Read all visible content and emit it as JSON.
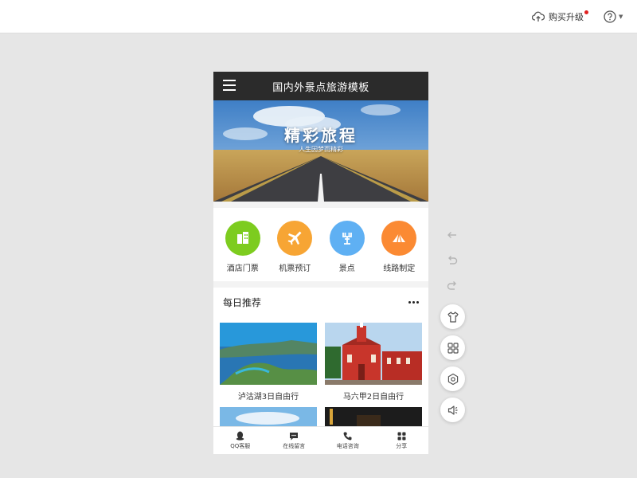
{
  "topbar": {
    "upgrade_label": "购买升级",
    "upgrade_icon": "cloud-upload-icon",
    "help_icon": "question-circle-icon"
  },
  "phone": {
    "title": "国内外景点旅游模板",
    "menu_icon": "hamburger-icon",
    "banner": {
      "headline": "精彩旅程",
      "subline": "人生因梦而精彩"
    },
    "quick_links": [
      {
        "label": "酒店门票",
        "icon": "hotel-building-icon",
        "color": "#7dcc1f"
      },
      {
        "label": "机票预订",
        "icon": "airplane-icon",
        "color": "#f7a534"
      },
      {
        "label": "景点",
        "icon": "landmark-icon",
        "color": "#5fb0f3"
      },
      {
        "label": "线路制定",
        "icon": "route-tent-icon",
        "color": "#fb8a33"
      }
    ],
    "recommend": {
      "title": "每日推荐",
      "items": [
        {
          "label": "泸沽湖3日自由行"
        },
        {
          "label": "马六甲2日自由行"
        }
      ]
    },
    "bottom_nav": [
      {
        "label": "QQ客服",
        "icon": "qq-penguin-icon"
      },
      {
        "label": "在线留言",
        "icon": "chat-bubble-icon"
      },
      {
        "label": "电话咨询",
        "icon": "phone-icon"
      },
      {
        "label": "分享",
        "icon": "share-grid-icon"
      }
    ]
  },
  "tools": {
    "undo_icons": [
      "back-arrow-icon",
      "undo-icon",
      "redo-icon"
    ],
    "buttons": [
      "shirt-icon",
      "grid-apps-icon",
      "gear-icon",
      "speaker-icon"
    ]
  },
  "colors": {
    "header_bg": "#2b2b2b",
    "page_bg": "#e6e6e6",
    "notification_dot": "#e02020"
  }
}
